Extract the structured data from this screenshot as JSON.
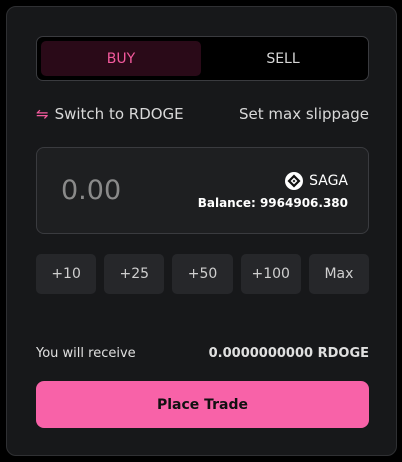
{
  "tabs": {
    "buy_label": "BUY",
    "sell_label": "SELL",
    "active": "buy"
  },
  "links": {
    "switch_label": "Switch to RDOGE",
    "switch_icon": "swap-arrows-icon",
    "slippage_label": "Set max slippage"
  },
  "amount": {
    "placeholder": "0.00",
    "token_name": "SAGA",
    "token_icon": "saga-logo-icon",
    "balance_text": "Balance: 9964906.380"
  },
  "presets": [
    "+10",
    "+25",
    "+50",
    "+100",
    "Max"
  ],
  "receive": {
    "label": "You will receive",
    "value": "0.0000000000 RDOGE"
  },
  "action": {
    "label": "Place Trade"
  },
  "colors": {
    "accent": "#f862a8",
    "accent_text": "#f45a9d",
    "card_bg": "#17181a"
  }
}
